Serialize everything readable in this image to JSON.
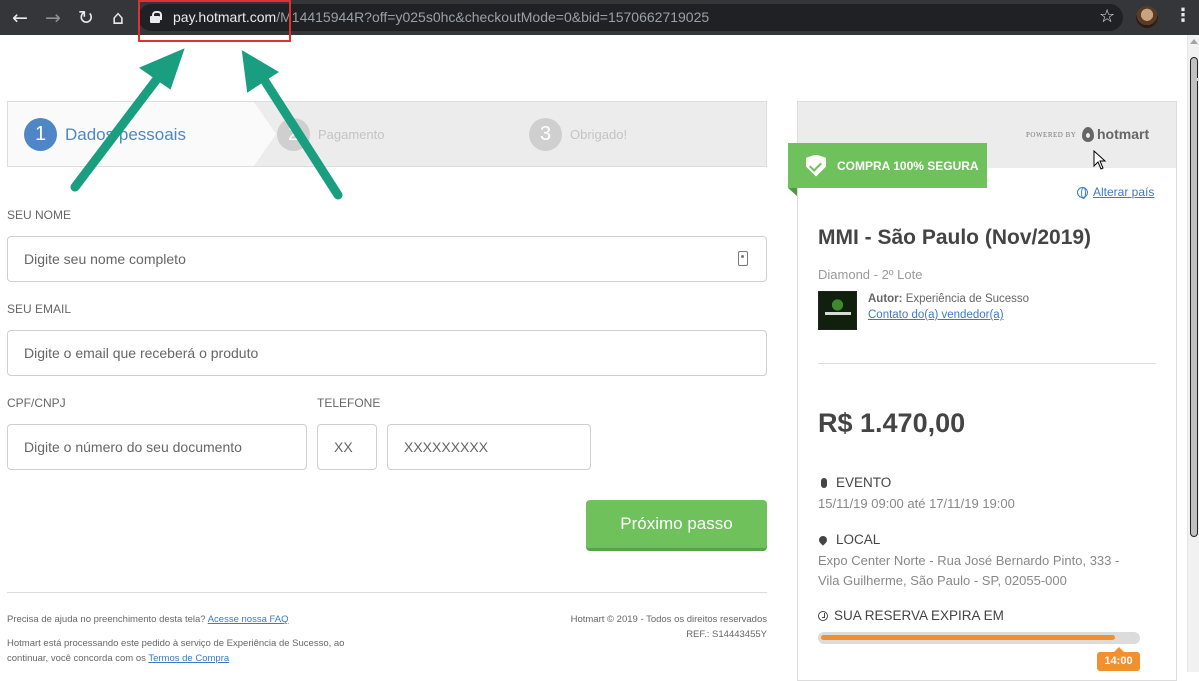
{
  "browser": {
    "url_host": "pay.hotmart.com",
    "url_path": "/M14415944R?off=y025s0hc&checkoutMode=0&bid=1570662719025",
    "icons": [
      "back-icon",
      "forward-icon",
      "reload-icon",
      "home-icon",
      "lock-icon",
      "star-icon",
      "avatar",
      "menu-icon"
    ]
  },
  "steps": [
    {
      "num": "1",
      "label": "Dados pessoais"
    },
    {
      "num": "2",
      "label": "Pagamento"
    },
    {
      "num": "3",
      "label": "Obrigado!"
    }
  ],
  "form": {
    "name_label": "SEU NOME",
    "name_placeholder": "Digite seu nome completo",
    "email_label": "SEU EMAIL",
    "email_placeholder": "Digite o email que receberá o produto",
    "doc_label": "CPF/CNPJ",
    "doc_placeholder": "Digite o número do seu documento",
    "phone_label": "TELEFONE",
    "ddd_placeholder": "XX",
    "phone_placeholder": "XXXXXXXXX",
    "next_button": "Próximo passo"
  },
  "footer": {
    "help_text": "Precisa de ajuda no preenchimento desta tela?",
    "help_link": "Acesse nossa FAQ",
    "processing_text_1": "Hotmart está processando este pedido à serviço de Experiência de Sucesso, ao",
    "processing_text_2": "continuar, você concorda com os",
    "terms_link": "Termos de Compra",
    "copyright": "Hotmart © 2019 - Todos os direitos reservados",
    "ref": "REF.: S14443455Y"
  },
  "panel": {
    "powered_by": "POWERED BY",
    "brand": "hotmart",
    "secure_badge": "COMPRA 100% SEGURA",
    "change_country": "Alterar país",
    "product_title": "MMI - São Paulo (Nov/2019)",
    "product_subtitle": "Diamond - 2º Lote",
    "author_label": "Autor:",
    "author_name": "Experiência de Sucesso",
    "contact_link": "Contato do(a) vendedor(a)",
    "price": "R$ 1.470,00",
    "event_title": "EVENTO",
    "event_dates": "15/11/19 09:00 até 17/11/19 19:00",
    "local_title": "LOCAL",
    "local_line_1": "Expo Center Norte - Rua José Bernardo Pinto, 333 -",
    "local_line_2": "Vila Guilherme, São Paulo - SP, 02055-000",
    "reserve_title": "SUA RESERVA EXPIRA EM",
    "reserve_progress": 0.93,
    "timer": "14:00"
  },
  "colors": {
    "accent_blue": "#4f86c6",
    "green": "#6fc15b",
    "orange": "#f2902f",
    "annotation_arrow": "#1a9e80",
    "annotation_box": "#e0312f"
  }
}
